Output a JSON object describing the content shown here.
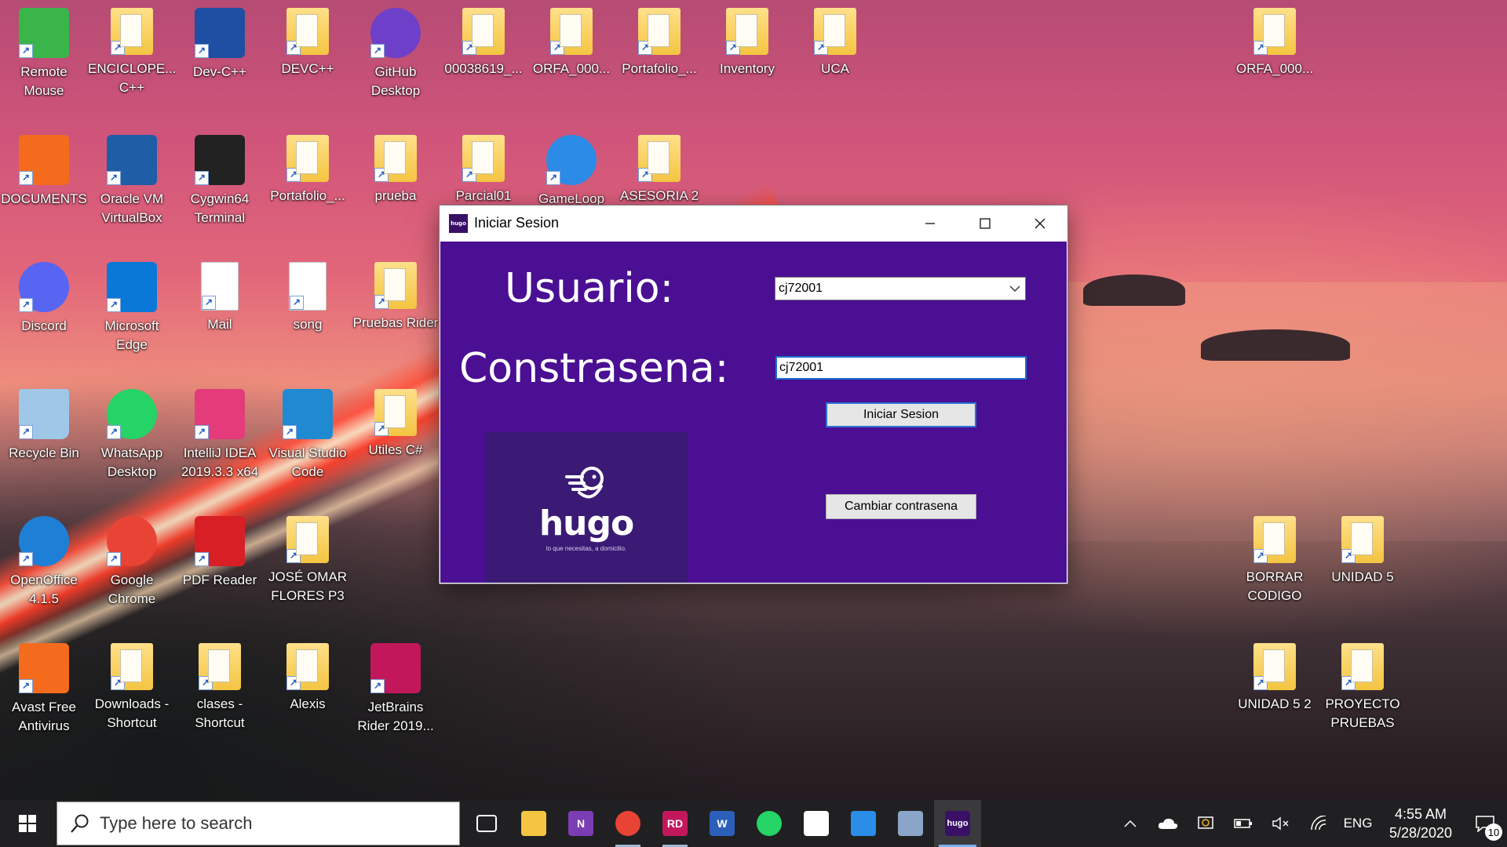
{
  "desktop_icons": [
    {
      "label": "Remote Mouse",
      "icon": "remote-mouse-icon",
      "color": "#3ab54a"
    },
    {
      "label": "ENCICLOPE... C++",
      "icon": "folder-icon",
      "color": "#f4c542"
    },
    {
      "label": "Dev-C++",
      "icon": "devcpp-icon",
      "color": "#1e4fa3"
    },
    {
      "label": "DEVC++",
      "icon": "folder-icon",
      "color": "#f4c542"
    },
    {
      "label": "GitHub Desktop",
      "icon": "github-icon",
      "color": "#6e40c9"
    },
    {
      "label": "00038619_...",
      "icon": "folder-icon",
      "color": "#f4c542"
    },
    {
      "label": "ORFA_000...",
      "icon": "folder-icon",
      "color": "#f4c542"
    },
    {
      "label": "Portafolio_...",
      "icon": "folder-icon",
      "color": "#f4c542"
    },
    {
      "label": "Inventory",
      "icon": "folder-icon",
      "color": "#f4c542"
    },
    {
      "label": "UCA",
      "icon": "folder-icon",
      "color": "#f4c542"
    },
    {
      "label": "ORFA_000...",
      "icon": "folder-icon",
      "color": "#f4c542"
    },
    {
      "label": "DOCUMENTS",
      "icon": "avast-doc-icon",
      "color": "#f46b1e"
    },
    {
      "label": "Oracle VM VirtualBox",
      "icon": "virtualbox-icon",
      "color": "#1f5da6"
    },
    {
      "label": "Cygwin64 Terminal",
      "icon": "terminal-icon",
      "color": "#222"
    },
    {
      "label": "Portafolio_...",
      "icon": "folder-icon",
      "color": "#f4c542"
    },
    {
      "label": "prueba",
      "icon": "folder-icon",
      "color": "#f4c542"
    },
    {
      "label": "Parcial01",
      "icon": "folder-icon",
      "color": "#f4c542"
    },
    {
      "label": "GameLoop",
      "icon": "gameloop-icon",
      "color": "#2b8be6"
    },
    {
      "label": "ASESORIA 2",
      "icon": "folder-icon",
      "color": "#f4c542"
    },
    {
      "label": "Discord",
      "icon": "discord-icon",
      "color": "#5865f2"
    },
    {
      "label": "Microsoft Edge",
      "icon": "edge-icon",
      "color": "#0a78d7"
    },
    {
      "label": "Mail",
      "icon": "doc-icon",
      "color": "#ffffff"
    },
    {
      "label": "song",
      "icon": "doc-icon",
      "color": "#ffffff"
    },
    {
      "label": "Pruebas Rider",
      "icon": "folder-icon",
      "color": "#f4c542"
    },
    {
      "label": "Recycle Bin",
      "icon": "recycle-bin-icon",
      "color": "#9fc7e8"
    },
    {
      "label": "WhatsApp Desktop",
      "icon": "whatsapp-icon",
      "color": "#25d366"
    },
    {
      "label": "IntelliJ IDEA 2019.3.3 x64",
      "icon": "intellij-icon",
      "color": "#e43b7b"
    },
    {
      "label": "Visual Studio Code",
      "icon": "vscode-icon",
      "color": "#1f8ad2"
    },
    {
      "label": "Utiles C#",
      "icon": "folder-icon",
      "color": "#f4c542"
    },
    {
      "label": "OpenOffice 4.1.5",
      "icon": "openoffice-icon",
      "color": "#1e7fd6"
    },
    {
      "label": "Google Chrome",
      "icon": "chrome-icon",
      "color": "#e84335"
    },
    {
      "label": "PDF Reader",
      "icon": "pdf-icon",
      "color": "#d81f26"
    },
    {
      "label": "JOSÉ OMAR FLORES P3",
      "icon": "folder-icon",
      "color": "#f4c542"
    },
    {
      "label": "BORRAR CODIGO",
      "icon": "folder-icon",
      "color": "#f4c542"
    },
    {
      "label": "UNIDAD 5",
      "icon": "folder-icon",
      "color": "#f4c542"
    },
    {
      "label": "Avast Free Antivirus",
      "icon": "avast-icon",
      "color": "#f46b1e"
    },
    {
      "label": "Downloads - Shortcut",
      "icon": "downloads-folder-icon",
      "color": "#f4c542"
    },
    {
      "label": "clases - Shortcut",
      "icon": "folder-icon",
      "color": "#f4c542"
    },
    {
      "label": "Alexis",
      "icon": "folder-icon",
      "color": "#f4c542"
    },
    {
      "label": "JetBrains Rider 2019...",
      "icon": "rider-icon",
      "color": "#c2185b"
    },
    {
      "label": "UNIDAD 5 2",
      "icon": "folder-icon",
      "color": "#f4c542"
    },
    {
      "label": "PROYECTO PRUEBAS",
      "icon": "folder-icon",
      "color": "#f4c542"
    }
  ],
  "dialog": {
    "title": "Iniciar Sesion",
    "app_icon_text": "hugo",
    "usuario_label": "Usuario:",
    "password_label": "Constrasena:",
    "usuario_value": "cj72001",
    "password_value": "cj72001",
    "login_button": "Iniciar Sesion",
    "change_button": "Cambiar contrasena",
    "logo_word": "hugo",
    "logo_tagline": "lo que necesitas, a domicilio.",
    "background_color": "#4a0f92"
  },
  "taskbar": {
    "search_placeholder": "Type here to search",
    "apps": [
      {
        "name": "task-view",
        "icon": "task-view-icon",
        "color": "#202022",
        "text": ""
      },
      {
        "name": "file-explorer",
        "icon": "file-explorer-icon",
        "color": "#f4c542",
        "text": ""
      },
      {
        "name": "onenote",
        "icon": "onenote-icon",
        "color": "#7b3db3",
        "text": "N"
      },
      {
        "name": "chrome",
        "icon": "chrome-icon",
        "color": "#e84335",
        "text": ""
      },
      {
        "name": "rider",
        "icon": "rider-icon",
        "color": "#c2185b",
        "text": "RD"
      },
      {
        "name": "word",
        "icon": "word-icon",
        "color": "#2b5fb9",
        "text": "W"
      },
      {
        "name": "whatsapp",
        "icon": "whatsapp-icon",
        "color": "#25d366",
        "text": ""
      },
      {
        "name": "slack",
        "icon": "slack-icon",
        "color": "#ffffff",
        "text": ""
      },
      {
        "name": "mail",
        "icon": "mail-icon",
        "color": "#2a8ee8",
        "text": ""
      },
      {
        "name": "postgres",
        "icon": "elephant-icon",
        "color": "#8aa5c7",
        "text": ""
      },
      {
        "name": "hugo",
        "icon": "hugo-app-icon",
        "color": "#3a1066",
        "text": "hugo"
      }
    ],
    "language": "ENG",
    "time": "4:55 AM",
    "date": "5/28/2020",
    "notification_count": "10"
  }
}
